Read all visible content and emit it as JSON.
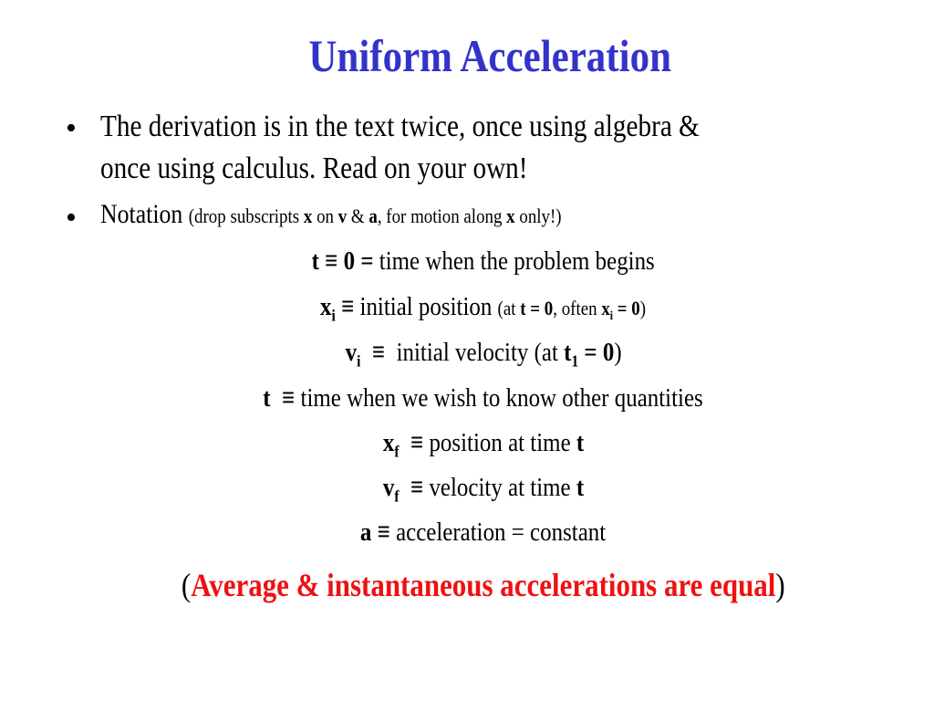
{
  "slide": {
    "title": "Uniform Acceleration",
    "bullets": [
      {
        "line1": "The derivation is in the text twice, once using algebra &",
        "line2": "once using calculus. Read on your own!"
      },
      {
        "main": "Notation",
        "note_open": "(drop subscripts ",
        "x": "x",
        "on": " on ",
        "v": "v",
        "amp": " & ",
        "a": "a",
        "rest": ", for motion along ",
        "x2": "x",
        "close": " only!)"
      }
    ],
    "definitions": [
      {
        "symbol": "t",
        "equiv": " ≡ 0 = ",
        "text": "time when the problem begins"
      },
      {
        "symbol": "x",
        "sub": "i",
        "equiv": " ≡ ",
        "text": "initial position ",
        "note_pre": "(at ",
        "note_b1": "t = 0",
        "note_mid": ", often ",
        "note_b2": "x",
        "note_sub": "i",
        "note_b3": " = 0",
        "note_post": ")"
      },
      {
        "symbol": "v",
        "sub": "i",
        "equiv": "  ≡  ",
        "text": "initial velocity (at ",
        "note_b1": "t",
        "note_sub": "1",
        "note_b2": " = 0",
        "note_post": ")"
      },
      {
        "symbol": "t",
        "equiv": "  ≡ ",
        "text": "time when we wish to know other quantities"
      },
      {
        "symbol": "x",
        "sub": "f",
        "equiv": "  ≡ ",
        "text": "position at time ",
        "trail": "t"
      },
      {
        "symbol": "v",
        "sub": "f",
        "equiv": "  ≡ ",
        "text": "velocity at time ",
        "trail": "t"
      },
      {
        "symbol": "a",
        "equiv": " ≡ ",
        "text": "acceleration = constant"
      }
    ],
    "conclusion": {
      "open": "(",
      "text": "Average & instantaneous accelerations are equal",
      "close": ")"
    },
    "colors": {
      "title": "#3333cc",
      "highlight": "#ee1111"
    }
  }
}
